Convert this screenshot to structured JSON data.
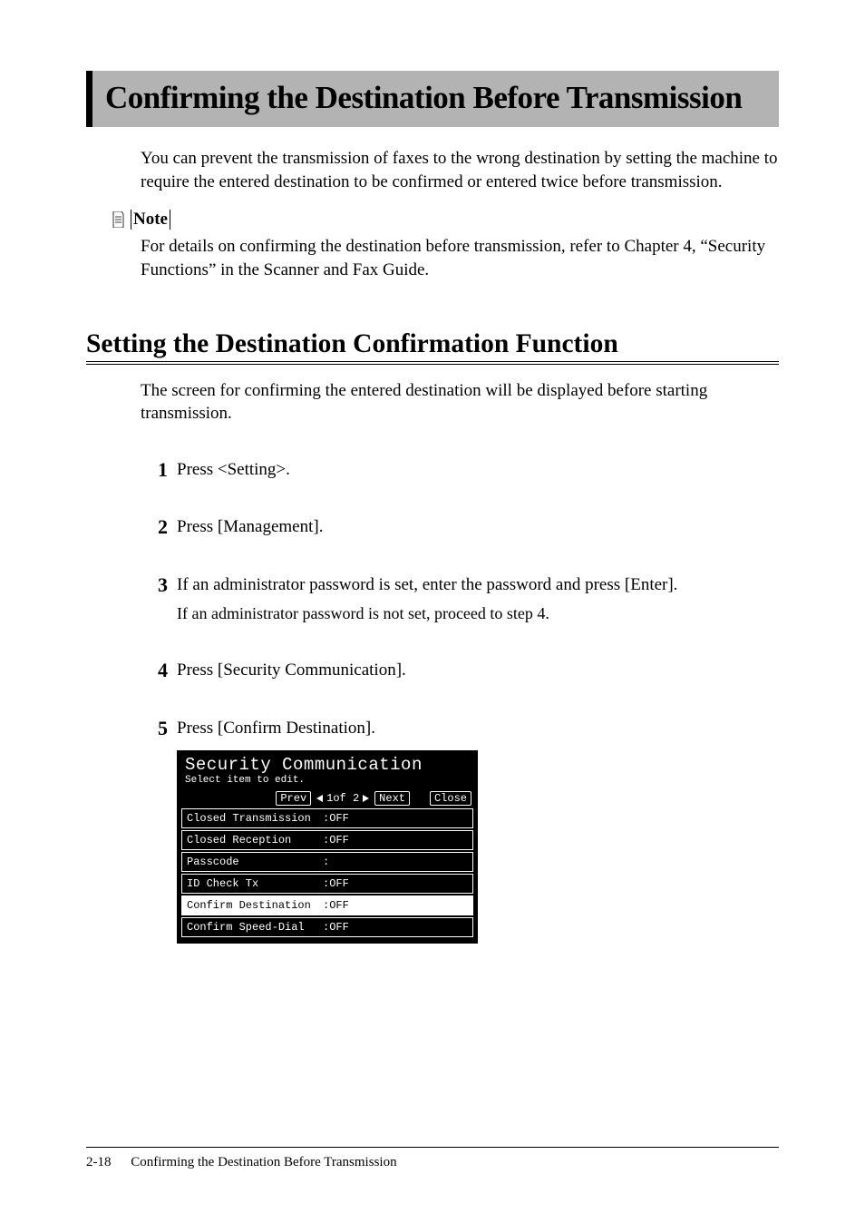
{
  "title": "Confirming the Destination Before Transmission",
  "intro": "You can prevent the transmission of faxes to the wrong destination by setting the machine to require the entered destination to be confirmed or entered twice before transmission.",
  "note_label": "Note",
  "note_body": "For details on confirming the destination before transmission, refer to Chapter 4, “Security Functions” in the Scanner and Fax Guide.",
  "section_heading": "Setting the Destination Confirmation Function",
  "section_intro": "The screen for confirming the entered destination will be displayed before starting transmission.",
  "steps": [
    {
      "n": "1",
      "text": "Press <Setting>."
    },
    {
      "n": "2",
      "text": "Press [Management]."
    },
    {
      "n": "3",
      "text": "If an administrator password is set, enter the password and press [Enter].",
      "sub": "If an administrator password is not set, proceed to step 4."
    },
    {
      "n": "4",
      "text": "Press [Security Communication]."
    },
    {
      "n": "5",
      "text": "Press [Confirm Destination]."
    }
  ],
  "lcd": {
    "title": "Security Communication",
    "subtitle": "Select item to edit.",
    "prev": "Prev",
    "next": "Next",
    "close": "Close",
    "page_label": "1of  2",
    "rows": [
      {
        "key": "Closed Transmission",
        "val": ":OFF",
        "selected": false
      },
      {
        "key": "Closed Reception",
        "val": ":OFF",
        "selected": false
      },
      {
        "key": "Passcode",
        "val": ":",
        "selected": false
      },
      {
        "key": "ID Check Tx",
        "val": ":OFF",
        "selected": false
      },
      {
        "key": "Confirm Destination",
        "val": ":OFF",
        "selected": true
      },
      {
        "key": "Confirm Speed-Dial",
        "val": ":OFF",
        "selected": false
      }
    ]
  },
  "footer": {
    "page": "2-18",
    "title": "Confirming the Destination Before Transmission"
  }
}
